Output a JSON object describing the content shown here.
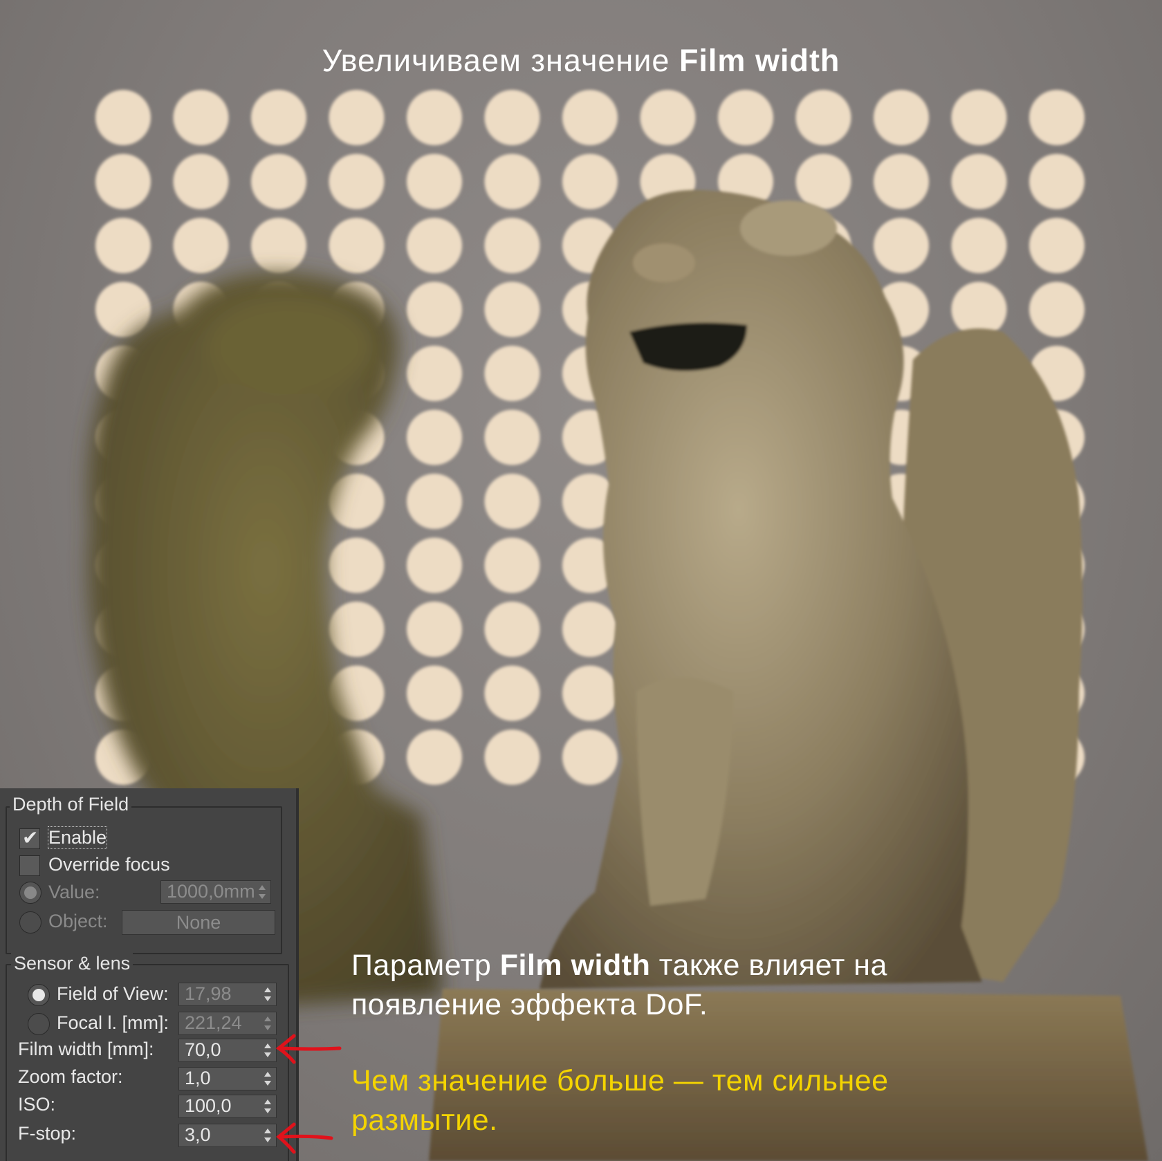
{
  "headline": {
    "prefix": "Увеличиваем значение ",
    "bold": "Film width"
  },
  "dof_panel": {
    "group_title": "Depth of Field",
    "enable": {
      "label": "Enable",
      "checked": true
    },
    "override_focus": {
      "label": "Override focus",
      "checked": false
    },
    "value": {
      "label": "Value:",
      "field": "1000,0mm"
    },
    "object": {
      "label": "Object:",
      "button": "None"
    }
  },
  "sensor_panel": {
    "group_title": "Sensor & lens",
    "field_of_view": {
      "label": "Field of View:",
      "value": "17,98"
    },
    "focal_length": {
      "label": "Focal l. [mm]:",
      "value": "221,24"
    },
    "film_width": {
      "label": "Film width [mm]:",
      "value": "70,0"
    },
    "zoom_factor": {
      "label": "Zoom factor:",
      "value": "1,0"
    },
    "iso": {
      "label": "ISO:",
      "value": "100,0"
    },
    "f_stop": {
      "label": "F-stop:",
      "value": "3,0"
    }
  },
  "caption": {
    "line1_prefix": "Параметр ",
    "line1_bold": "Film width",
    "line1_suffix": " также влияет на",
    "line2": "появление эффекта DoF.",
    "yellow_line1": "Чем значение больше — тем сильнее",
    "yellow_line2": "размытие."
  },
  "colors": {
    "bokeh": "#eddcc4",
    "annotation_arrow": "#e0121b",
    "highlight_text": "#f4d400",
    "panel_bg": "#444444"
  },
  "icons": [
    "checkmark-icon",
    "radio-icon",
    "spinner-arrows-icon",
    "red-arrow-icon"
  ]
}
